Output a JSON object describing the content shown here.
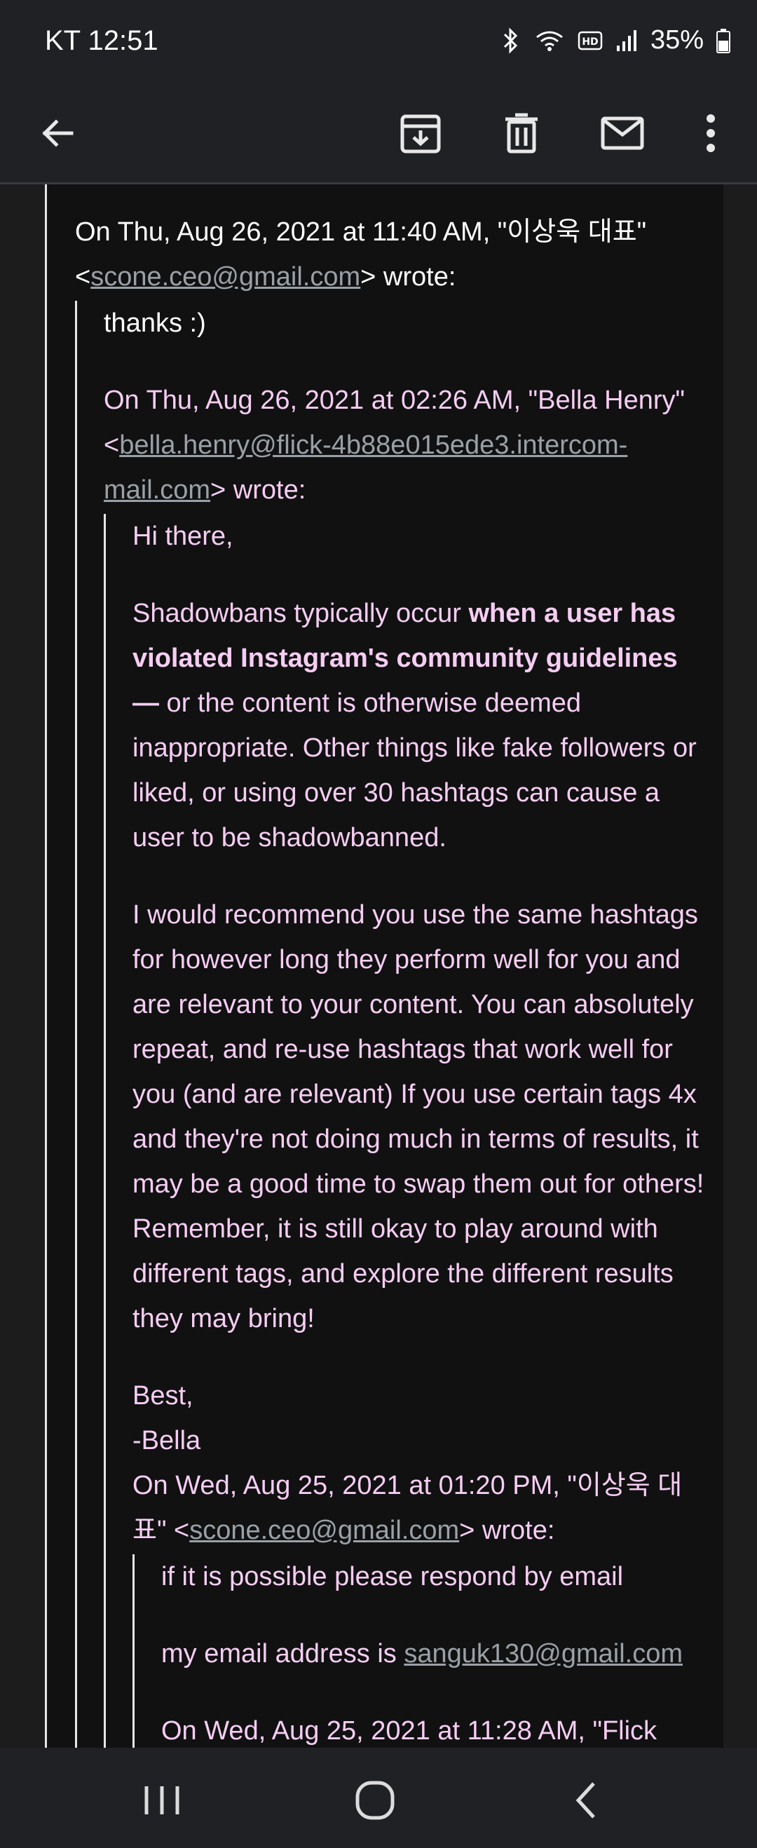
{
  "status": {
    "carrier_time": "KT  12:51",
    "battery": "35%"
  },
  "toolbar": {
    "back": "back-arrow-icon",
    "archive": "archive-icon",
    "delete": "trash-icon",
    "mark_unread": "mail-icon",
    "more": "more-vert-icon"
  },
  "thread": {
    "reply1_header_a": "On Thu, Aug 26, 2021 at 11:40 AM, \"이상욱 대표\"",
    "reply1_lt": "<",
    "reply1_email": "scone.ceo@gmail.com",
    "reply1_gt": "> wrote:",
    "reply1_body": "thanks :)",
    "reply2_header_a": "On Thu, Aug 26, 2021 at 02:26 AM, \"Bella Henry\"",
    "reply2_lt": "<",
    "reply2_email": "bella.henry@flick-4b88e015ede3.intercom-mail.com",
    "reply2_gt": "> wrote:",
    "greeting": "Hi there,",
    "p1_start": "Shadowbans typically occur ",
    "p1_bold": "when a user has violated Instagram's community guidelines —",
    "p1_end": " or the content is otherwise deemed inappropriate. Other things like fake followers or liked, or using over 30 hashtags can cause a user to be shadowbanned.",
    "p2": "I would recommend you use the same hashtags for however long they perform well for you and are relevant to your content. You can absolutely repeat, and re-use hashtags that work well for you (and are relevant) If you use certain tags 4x and they're not doing much in terms of results, it may be a good time to swap them out for others! Remember, it is still okay to play around with different tags, and explore the different results they may bring!",
    "signoff1": "Best,",
    "signoff2": "-Bella",
    "reply3_header_a": "On Wed, Aug 25, 2021 at 01:20 PM, \"이상욱 대표\" <",
    "reply3_email": "scone.ceo@gmail.com",
    "reply3_gt": "> wrote:",
    "q3_line1": "if it is possible please respond by email",
    "q3_line2_a": "my email address is ",
    "q3_line2_email": "sanguk130@gmail.com",
    "q3_line3": "On Wed, Aug 25, 2021 at 11:28 AM, \"Flick"
  },
  "nav": {
    "recents": "recents-icon",
    "home": "home-icon",
    "back": "nav-back-icon"
  }
}
